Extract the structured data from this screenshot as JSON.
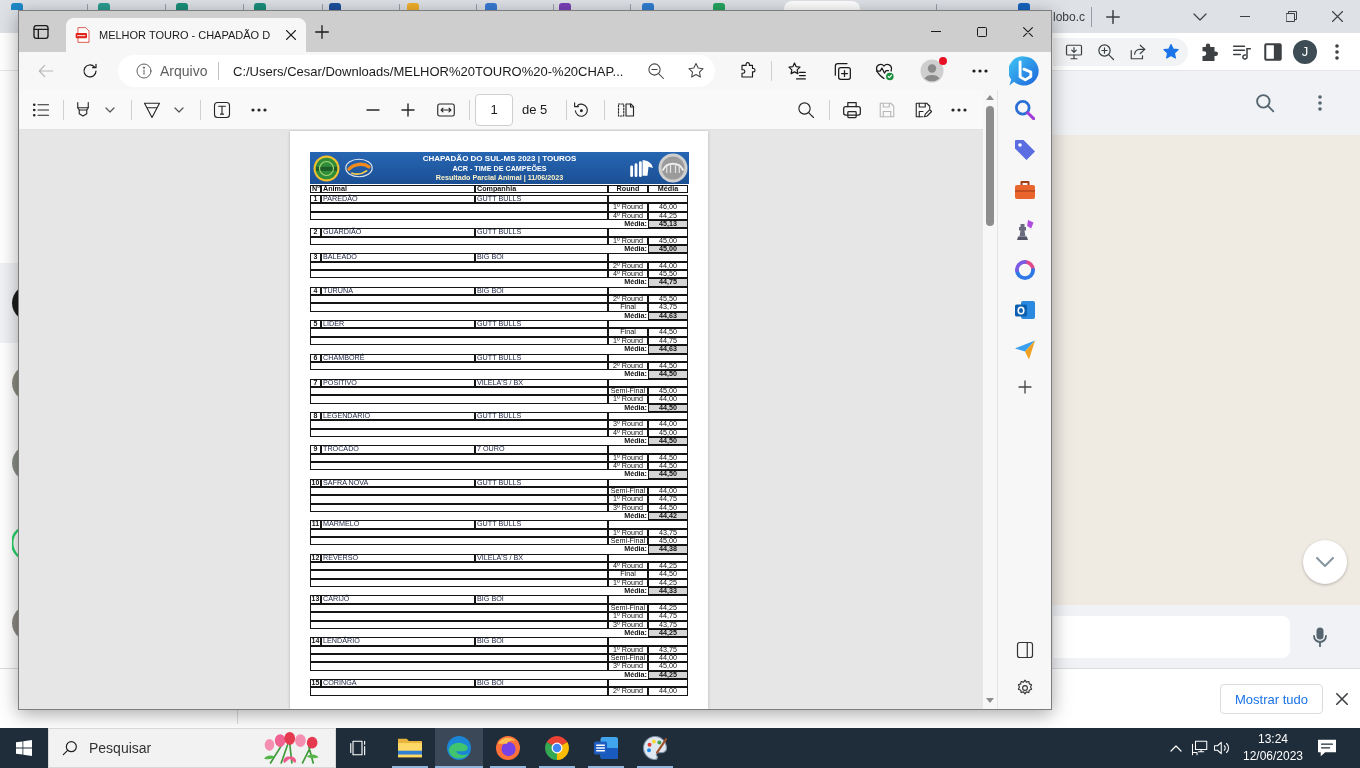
{
  "background_browser": {
    "tab_title": "lobo.c",
    "bookmarked": true,
    "profile_initial": "J",
    "chats": [
      {
        "selected": true
      },
      {
        "selected": false
      },
      {
        "selected": false
      },
      {
        "selected": false
      },
      {
        "selected": false
      }
    ],
    "download_bar": {
      "button": "Mostrar tudo"
    }
  },
  "pdf_window": {
    "tab": {
      "title": "MELHOR TOURO - CHAPADÃO D"
    },
    "back": {
      "disabled": true
    },
    "address": {
      "security_label": "Arquivo",
      "url": "C:/Users/Cesar/Downloads/MELHOR%20TOURO%20-%20CHAP..."
    },
    "profile": {
      "notification": true
    },
    "pdf_toolbar": {
      "page": "1",
      "page_count": "de 5",
      "save": {
        "disabled": true
      }
    },
    "document": {
      "title": "CHAPADÃO DO SUL-MS 2023 | TOUROS",
      "subtitle": "ACR - TIME DE CAMPEÕES",
      "caption": "Resultado Parcial Animal | 11/06/2023",
      "columns": [
        "Nº",
        "Animal",
        "Companhia",
        "Round",
        "Média"
      ],
      "animals": [
        {
          "number": "1",
          "name": "PAREDÃO",
          "company": "GUTT BULLS",
          "rounds": [
            {
              "round": "1º Round",
              "score": "46,00"
            },
            {
              "round": "4º Round",
              "score": "44,25"
            }
          ],
          "average_label": "Média:",
          "average": "45,13"
        },
        {
          "number": "2",
          "name": "GUARDIÃO",
          "company": "GUTT BULLS",
          "rounds": [
            {
              "round": "1º Round",
              "score": "45,00"
            }
          ],
          "average_label": "Média:",
          "average": "45,00"
        },
        {
          "number": "3",
          "name": "BALEADO",
          "company": "BIG BOI",
          "rounds": [
            {
              "round": "2º Round",
              "score": "44,00"
            },
            {
              "round": "4º Round",
              "score": "45,50"
            }
          ],
          "average_label": "Média:",
          "average": "44,75"
        },
        {
          "number": "4",
          "name": "TURUNA",
          "company": "BIG BOI",
          "rounds": [
            {
              "round": "2º Round",
              "score": "45,50"
            },
            {
              "round": "Final",
              "score": "43,75"
            }
          ],
          "average_label": "Média:",
          "average": "44,63"
        },
        {
          "number": "5",
          "name": "LIDER",
          "company": "GUTT BULLS",
          "rounds": [
            {
              "round": "Final",
              "score": "44,50"
            },
            {
              "round": "1º Round",
              "score": "44,75"
            }
          ],
          "average_label": "Média:",
          "average": "44,63"
        },
        {
          "number": "6",
          "name": "CHAMBORÉ",
          "company": "GUTT BULLS",
          "rounds": [
            {
              "round": "2º Round",
              "score": "44,50"
            }
          ],
          "average_label": "Média:",
          "average": "44,50"
        },
        {
          "number": "7",
          "name": "POSITIVO",
          "company": "VILELA'S / BX",
          "rounds": [
            {
              "round": "Semi-Final",
              "score": "45,00"
            },
            {
              "round": "1º Round",
              "score": "44,00"
            }
          ],
          "average_label": "Média:",
          "average": "44,50"
        },
        {
          "number": "8",
          "name": "LEGENDARIO",
          "company": "GUTT BULLS",
          "rounds": [
            {
              "round": "3º Round",
              "score": "44,00"
            },
            {
              "round": "4º Round",
              "score": "45,00"
            }
          ],
          "average_label": "Média:",
          "average": "44,50"
        },
        {
          "number": "9",
          "name": "TROCADO",
          "company": "7 OURO",
          "rounds": [
            {
              "round": "1º Round",
              "score": "44,50"
            },
            {
              "round": "4º Round",
              "score": "44,50"
            }
          ],
          "average_label": "Média:",
          "average": "44,50"
        },
        {
          "number": "10",
          "name": "SAFRA NOVA",
          "company": "GUTT BULLS",
          "rounds": [
            {
              "round": "Semi-Final",
              "score": "44,00"
            },
            {
              "round": "1º Round",
              "score": "44,75"
            },
            {
              "round": "3º Round",
              "score": "44,50"
            }
          ],
          "average_label": "Média:",
          "average": "44,42"
        },
        {
          "number": "11",
          "name": "MARMELO",
          "company": "GUTT BULLS",
          "rounds": [
            {
              "round": "1º Round",
              "score": "43,75"
            },
            {
              "round": "Semi-Final",
              "score": "45,00"
            }
          ],
          "average_label": "Média:",
          "average": "44,38"
        },
        {
          "number": "12",
          "name": "REVERSO",
          "company": "VILELA'S / BX",
          "rounds": [
            {
              "round": "4º Round",
              "score": "44,25"
            },
            {
              "round": "Final",
              "score": "44,50"
            },
            {
              "round": "1º Round",
              "score": "44,25"
            }
          ],
          "average_label": "Média:",
          "average": "44,33"
        },
        {
          "number": "13",
          "name": "CARIJÓ",
          "company": "BIG BOI",
          "rounds": [
            {
              "round": "Semi-Final",
              "score": "44,25"
            },
            {
              "round": "1º Round",
              "score": "44,75"
            },
            {
              "round": "3º Round",
              "score": "43,75"
            }
          ],
          "average_label": "Média:",
          "average": "44,25"
        },
        {
          "number": "14",
          "name": "LENDÁRIO",
          "company": "BIG BOI",
          "rounds": [
            {
              "round": "1º Round",
              "score": "43,75"
            },
            {
              "round": "Semi-Final",
              "score": "44,00"
            },
            {
              "round": "3º Round",
              "score": "45,00"
            }
          ],
          "average_label": "Média:",
          "average": "44,25"
        },
        {
          "number": "15",
          "name": "CORINGA",
          "company": "BIG BOI",
          "rounds": [
            {
              "round": "2º Round",
              "score": "44,00"
            }
          ]
        }
      ]
    }
  },
  "taskbar": {
    "search": {
      "placeholder": "Pesquisar"
    },
    "apps": [
      {
        "selected": false,
        "running": true
      },
      {
        "selected": true,
        "running": true
      },
      {
        "selected": false,
        "running": true
      },
      {
        "selected": false,
        "running": true
      },
      {
        "selected": false,
        "running": true
      },
      {
        "selected": false,
        "running": true
      }
    ],
    "time": "13:24",
    "date": "12/06/2023"
  }
}
